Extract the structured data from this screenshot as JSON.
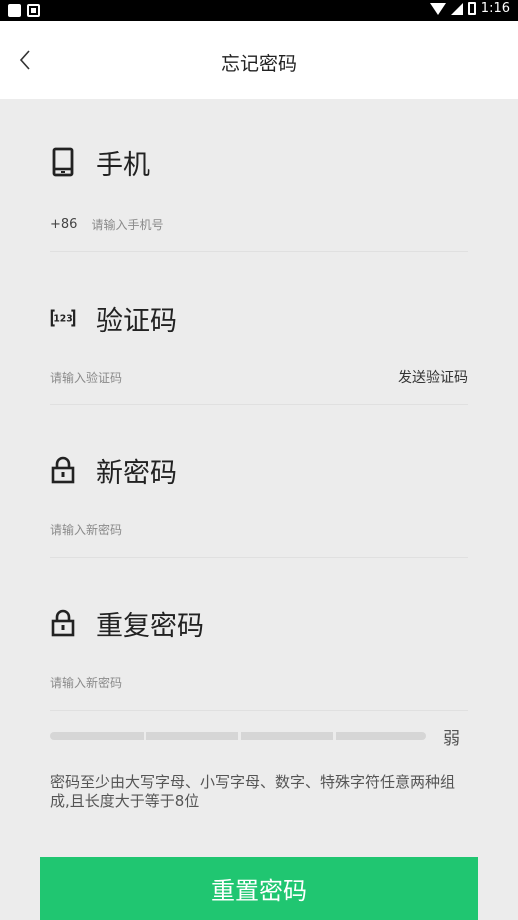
{
  "status_bar": {
    "time": "1:16"
  },
  "header": {
    "title": "忘记密码"
  },
  "phone": {
    "title": "手机",
    "prefix": "+86",
    "placeholder": "请输入手机号"
  },
  "code": {
    "title": "验证码",
    "placeholder": "请输入验证码",
    "send_label": "发送验证码"
  },
  "new_password": {
    "title": "新密码",
    "placeholder": "请输入新密码"
  },
  "repeat_password": {
    "title": "重复密码",
    "placeholder": "请输入新密码"
  },
  "strength": {
    "label": "弱",
    "level": 0
  },
  "hint": "密码至少由大写字母、小写字母、数字、特殊字符任意两种组成,且长度大于等于8位",
  "submit_label": "重置密码",
  "colors": {
    "accent": "#20c671",
    "background": "#ececec"
  },
  "icons": [
    "back-icon",
    "phone-icon",
    "code-123-icon",
    "lock-icon"
  ]
}
